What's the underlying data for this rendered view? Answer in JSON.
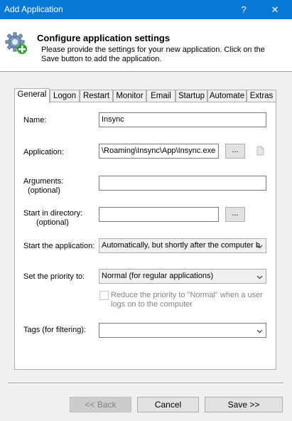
{
  "window": {
    "title": "Add Application",
    "help_label": "?",
    "close_label": "✕"
  },
  "header": {
    "heading": "Configure application settings",
    "description": "Please provide the settings for your new application. Click on the Save button to add the application.",
    "icon": "gear-add-icon"
  },
  "tabs": [
    {
      "label": "General",
      "active": true
    },
    {
      "label": "Logon"
    },
    {
      "label": "Restart"
    },
    {
      "label": "Monitor"
    },
    {
      "label": "Email"
    },
    {
      "label": "Startup"
    },
    {
      "label": "Automate"
    },
    {
      "label": "Extras"
    }
  ],
  "form": {
    "name": {
      "label": "Name:",
      "value": "Insync"
    },
    "application": {
      "label": "Application:",
      "value": "\\Roaming\\Insync\\App\\Insync.exe",
      "browse_label": "..."
    },
    "arguments": {
      "label": "Arguments:",
      "sublabel": "(optional)",
      "value": ""
    },
    "start_dir": {
      "label": "Start in directory:",
      "sublabel": "(optional)",
      "value": "",
      "browse_label": "..."
    },
    "start_app": {
      "label": "Start the application:",
      "value": "Automatically, but shortly after the computer b"
    },
    "priority": {
      "label": "Set the priority to:",
      "value": "Normal (for regular applications)"
    },
    "reduce_priority": {
      "label_line1": "Reduce the priority to \"Normal\" when a user",
      "label_line2": "logs on to the computer",
      "checked": false
    },
    "tags": {
      "label": "Tags (for filtering):",
      "value": ""
    }
  },
  "buttons": {
    "back": "<< Back",
    "cancel": "Cancel",
    "save": "Save >>"
  },
  "colors": {
    "titlebar": "#0a78d7",
    "dialog_bg": "#f0f0f0"
  }
}
